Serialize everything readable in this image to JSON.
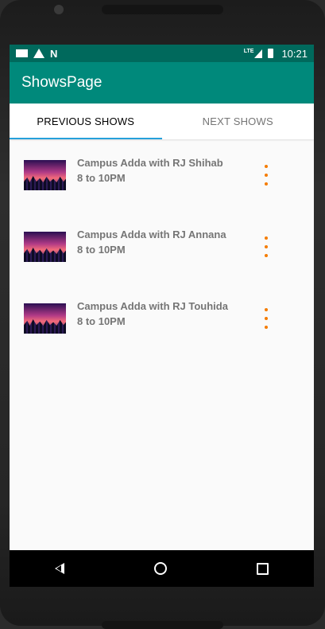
{
  "status_bar": {
    "left_icons": [
      "notification-rect-icon",
      "warning-icon",
      "n-icon"
    ],
    "network": "LTE",
    "battery_label": "",
    "time": "10:21"
  },
  "app_bar": {
    "title": "ShowsPage"
  },
  "tabs": [
    {
      "label": "PREVIOUS SHOWS",
      "selected": true
    },
    {
      "label": "NEXT SHOWS",
      "selected": false
    }
  ],
  "shows": [
    {
      "title": "Campus Adda with RJ Shihab",
      "time": "8 to 10PM"
    },
    {
      "title": "Campus Adda with RJ Annana",
      "time": "8 to 10PM"
    },
    {
      "title": "Campus Adda with RJ Touhida",
      "time": "8 to 10PM"
    }
  ],
  "colors": {
    "status_bar": "#00695c",
    "app_bar": "#00897b",
    "tab_indicator": "#26a0da",
    "overflow_icon": "#f57c00"
  },
  "nav_bar": {
    "buttons": [
      "back-icon",
      "home-icon",
      "recents-icon"
    ]
  }
}
